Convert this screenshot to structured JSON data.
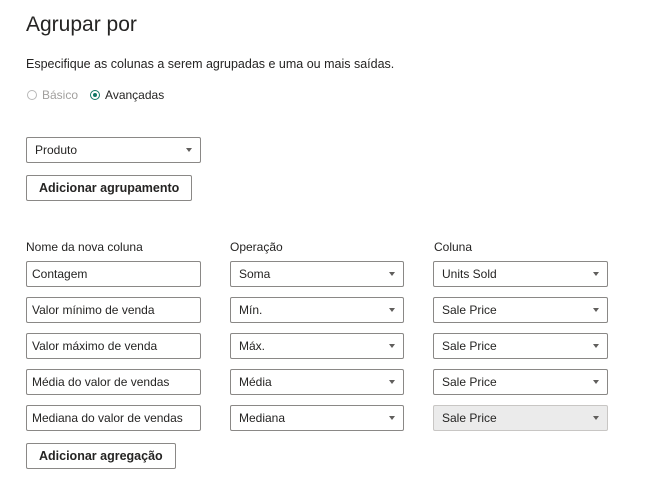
{
  "dialog": {
    "title": "Agrupar por",
    "description": "Especifique as colunas a serem agrupadas e uma ou mais saídas."
  },
  "mode": {
    "basic_label": "Básico",
    "advanced_label": "Avançadas",
    "selected": "Avançadas"
  },
  "group_by": {
    "column_value": "Produto",
    "add_grouping_label": "Adicionar agrupamento"
  },
  "aggregations": {
    "headers": {
      "new_column_name": "Nome da nova coluna",
      "operation": "Operação",
      "column": "Coluna"
    },
    "rows": [
      {
        "name": "Contagem",
        "operation": "Soma",
        "column": "Units Sold",
        "column_disabled": false
      },
      {
        "name": "Valor mínimo de venda",
        "operation": "Mín.",
        "column": "Sale Price",
        "column_disabled": false
      },
      {
        "name": "Valor máximo de venda",
        "operation": "Máx.",
        "column": "Sale Price",
        "column_disabled": false
      },
      {
        "name": "Média do valor de vendas",
        "operation": "Média",
        "column": "Sale Price",
        "column_disabled": false
      },
      {
        "name": "Mediana do valor de vendas",
        "operation": "Mediana",
        "column": "Sale Price",
        "column_disabled": true
      }
    ],
    "add_aggregation_label": "Adicionar agregação"
  },
  "colors": {
    "accent": "#117865",
    "disabled_field": "#ebebeb"
  }
}
